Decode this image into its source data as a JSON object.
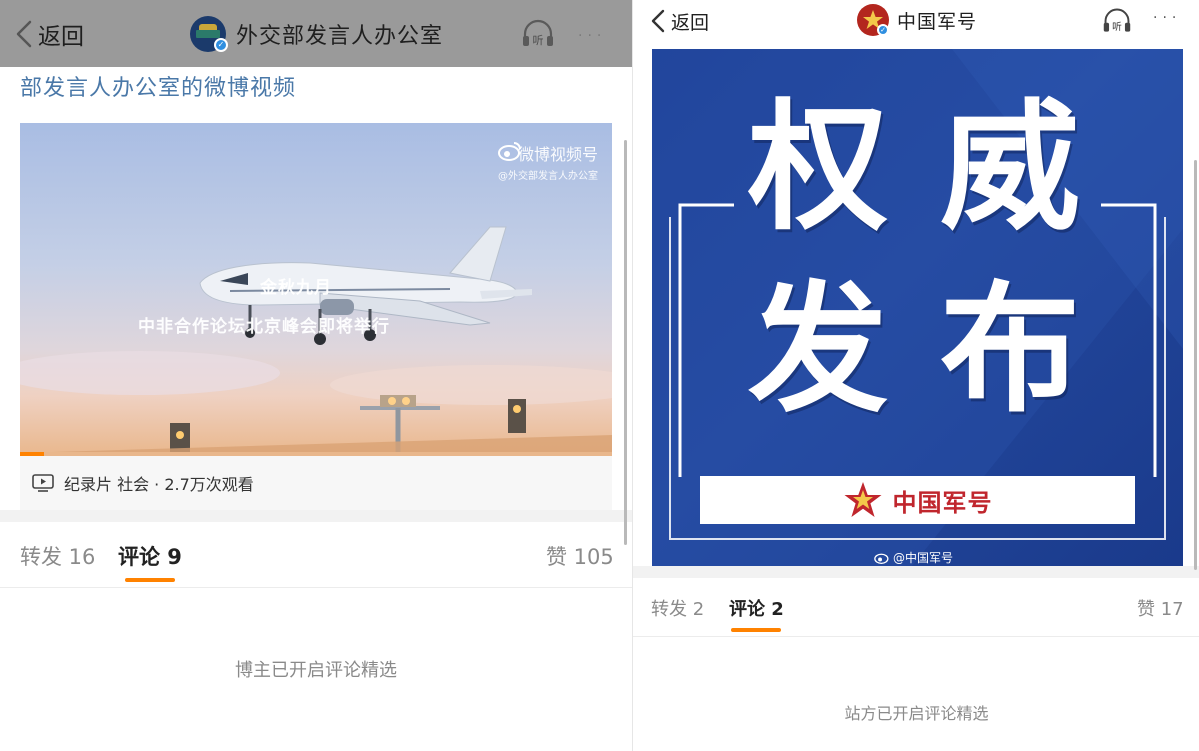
{
  "left": {
    "header": {
      "back_label": "返回",
      "title": "外交部发言人办公室",
      "more_label": "···",
      "listen_label": "听"
    },
    "post": {
      "link_text": "部发言人办公室的微博视频"
    },
    "video": {
      "watermark": "微博视频号",
      "watermark_sub": "@外交部发言人办公室",
      "caption_line1": "金秋九月",
      "caption_line2": "中非合作论坛北京峰会即将举行",
      "meta": "纪录片 社会 · 2.7万次观看",
      "progress": 0.04
    },
    "tabs": {
      "repost": "转发 16",
      "comments": "评论 9",
      "likes": "赞 105"
    },
    "notice": "博主已开启评论精选"
  },
  "right": {
    "header": {
      "back_label": "返回",
      "title": "中国军号",
      "more_label": "···",
      "listen_label": "听"
    },
    "poster": {
      "char1": "权",
      "char2": "威",
      "char3": "发",
      "char4": "布",
      "band_text": "中国军号",
      "credit": "@中国军号"
    },
    "tabs": {
      "repost": "转发 2",
      "comments": "评论 2",
      "likes": "赞 17"
    },
    "notice": "站方已开启评论精选"
  },
  "colors": {
    "accent": "#ff8200",
    "link": "#4a78a8",
    "poster_blue": "#1d3f95",
    "army_red": "#c0262d",
    "muted_text": "#8a8a8a"
  }
}
